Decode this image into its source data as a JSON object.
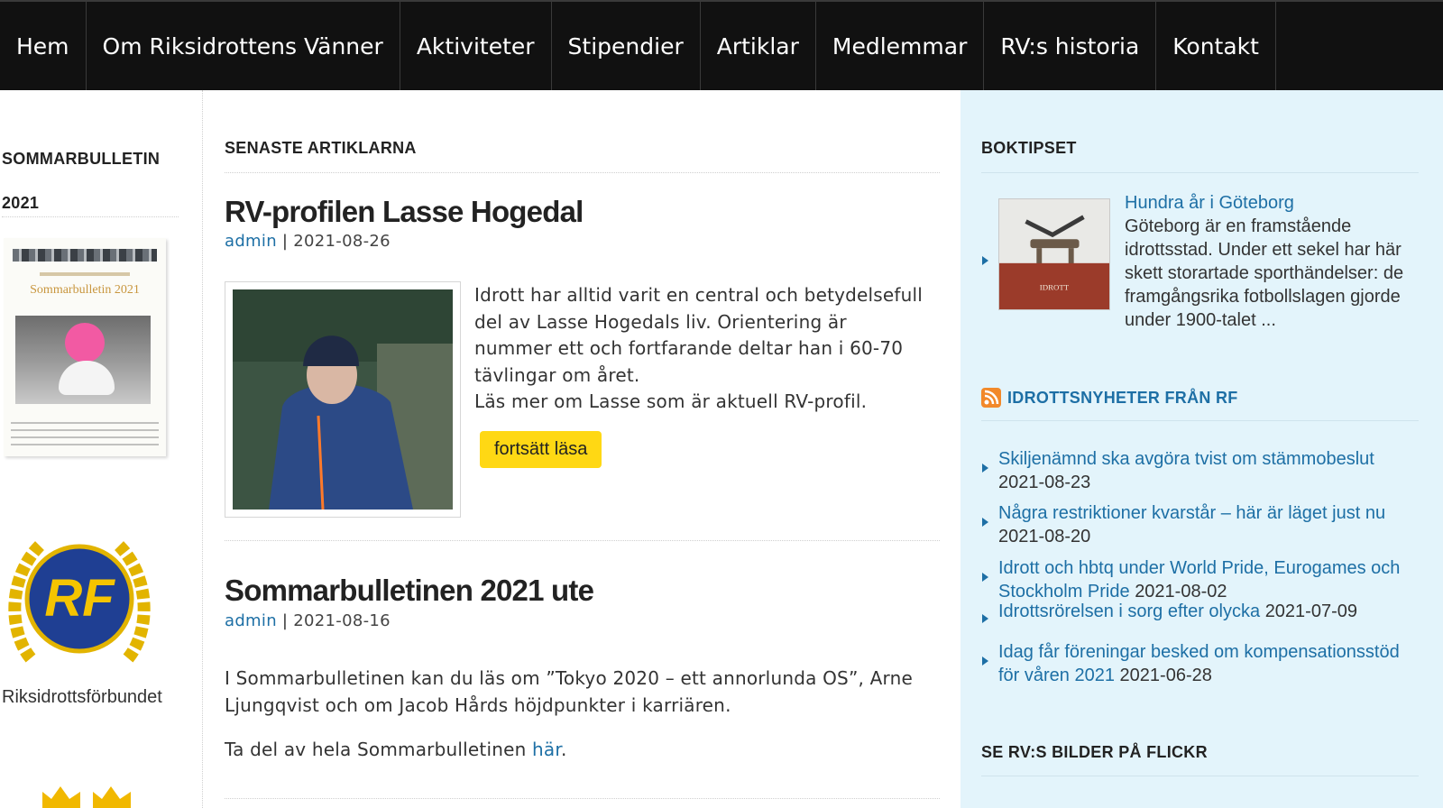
{
  "nav": {
    "items": [
      "Hem",
      "Om Riksidrottens Vänner",
      "Aktiviteter",
      "Stipendier",
      "Artiklar",
      "Medlemmar",
      "RV:s historia",
      "Kontakt"
    ]
  },
  "left": {
    "title": "SOMMARBULLETIN 2021",
    "bulletin_cover_title": "Sommarbulletin 2021",
    "rf_logo_letters": "RF",
    "rf_caption": "Riksidrottsförbundet"
  },
  "main": {
    "heading": "SENASTE ARTIKLARNA",
    "articles": [
      {
        "title": "RV-profilen Lasse Hogedal",
        "author": "admin",
        "separator": "|",
        "date": "2021-08-26",
        "excerpt": "Idrott har alltid varit en central och betydelsefull del av Lasse Hogedals liv. Orientering är nummer ett och fortfarande deltar han i 60-70 tävlingar om året.\nLäs mer om Lasse som är aktuell RV-profil.",
        "read_more": "fortsätt läsa"
      },
      {
        "title": "Sommarbulletinen 2021 ute",
        "author": "admin",
        "separator": "|",
        "date": "2021-08-16",
        "body": "I Sommarbulletinen kan du läs om ”Tokyo 2020 – ett annorlunda OS”, Arne Ljungqvist och om Jacob Hårds höjdpunkter i karriären.",
        "share_prefix": "Ta del av hela Sommarbulletinen ",
        "share_link": "här",
        "share_suffix": "."
      }
    ]
  },
  "right": {
    "book_heading": "BOKTIPSET",
    "book": {
      "cover_label": "IDROTT",
      "title": "Hundra år i Göteborg",
      "description": "Göteborg är en framstående idrottsstad. Under ett sekel har här skett storartade sporthändelser: de framgångsrika fotbollslagen gjorde under 1900-talet ..."
    },
    "news_heading": "IDROTTSNYHETER FRÅN RF",
    "news": [
      {
        "title": "Skiljenämnd ska avgöra tvist om stämmobeslut",
        "date": "2021-08-23"
      },
      {
        "title": "Några restriktioner kvarstår – här är läget just nu",
        "date": "2021-08-20"
      },
      {
        "title": "Idrott och hbtq under World Pride, Eurogames och Stockholm Pride",
        "date": "2021-08-02"
      },
      {
        "title": "Idrottsrörelsen i sorg efter olycka",
        "date": "2021-07-09"
      },
      {
        "title": "Idag får föreningar besked om kompensationsstöd för våren 2021",
        "date": "2021-06-28"
      }
    ],
    "flickr_heading": "SE RV:S BILDER PÅ FLICKR"
  },
  "colors": {
    "nav_bg": "#111111",
    "link": "#1d6fa5",
    "button": "#ffd814",
    "right_bg": "#e3f4fb",
    "rss": "#f2892a"
  },
  "icons": {
    "feed": "rss-icon",
    "list_bullet": "triangle-bullet-icon"
  }
}
